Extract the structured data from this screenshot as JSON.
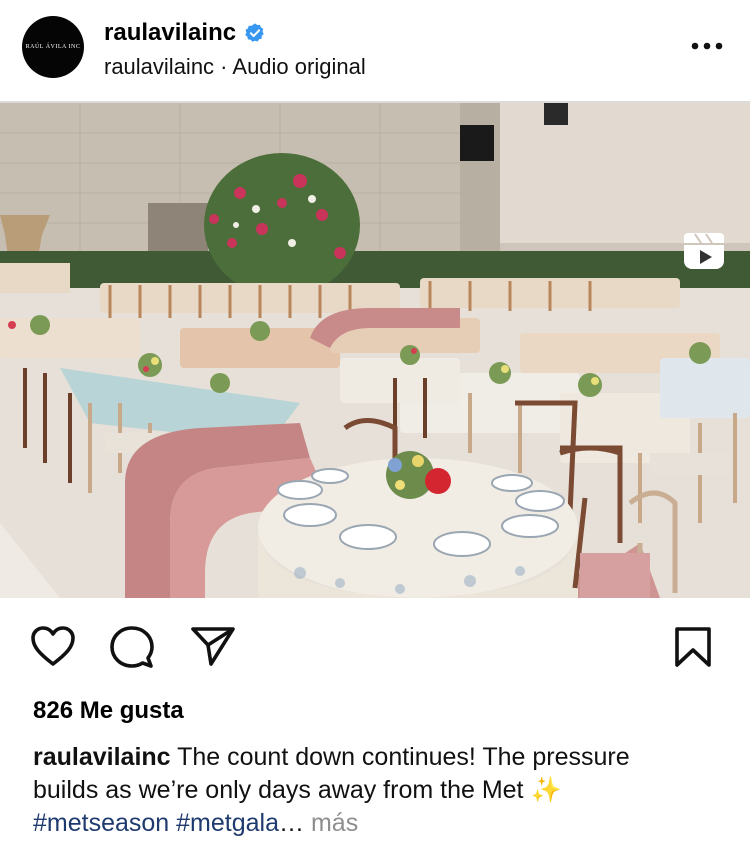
{
  "post": {
    "avatar_text": "RAÚL ÁVILA INC",
    "username": "raulavilainc",
    "subline": "raulavilainc · Audio original",
    "verified": true,
    "more_icon": "more-horizontal-icon",
    "media": {
      "type": "reel",
      "description_icon": "reels-icon",
      "mute_icon": "speaker-muted-icon"
    },
    "actions": {
      "like_icon": "heart-icon",
      "comment_icon": "comment-bubble-icon",
      "share_icon": "paper-plane-icon",
      "save_icon": "bookmark-icon"
    },
    "likes_text": "826 Me gusta",
    "caption": {
      "username": "raulavilainc",
      "text": "The count down continues! The pressure builds as we’re only days away from the Met",
      "emoji": "✨",
      "hashtag1": "#metseason",
      "hashtag2": "#metgala",
      "ellipsis": "…",
      "more_label": "más"
    },
    "colors": {
      "verified_blue": "#3897f0",
      "hashtag": "#1e3a6e",
      "muted_text": "#8e8e8e"
    }
  }
}
